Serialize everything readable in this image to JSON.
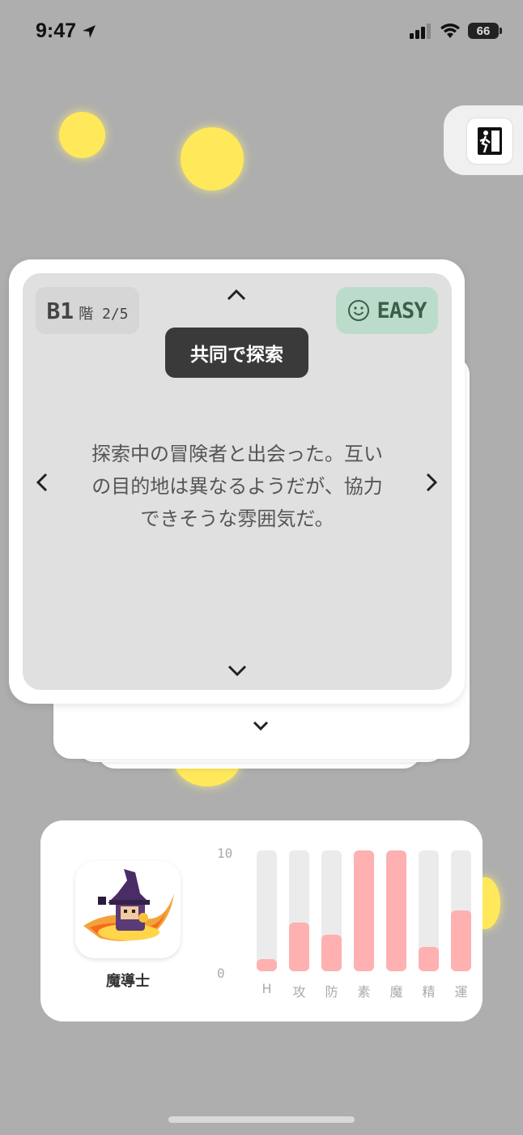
{
  "status": {
    "time": "9:47",
    "battery": "66"
  },
  "colors": {
    "background": "#aeaeae",
    "bubble": "#ffe95a",
    "bar_fill": "#ffb0b0",
    "bar_track": "#ebebeb",
    "easy_bg": "#bcdccb"
  },
  "exit": {
    "icon": "exit-running-icon"
  },
  "event_card": {
    "floor": "B1",
    "floor_progress": "階 2/5",
    "difficulty": "EASY",
    "difficulty_icon": "smiley-icon",
    "title": "共同で探索",
    "story_lines": [
      "探索中の冒険者と出会った。互い",
      "の目的地は異なるようだが、協力",
      "できそうな雰囲気だ。"
    ]
  },
  "character": {
    "name": "魔導士",
    "axis_max": "10",
    "axis_min": "0",
    "stats": [
      {
        "label": "H",
        "value": 1
      },
      {
        "label": "攻",
        "value": 4
      },
      {
        "label": "防",
        "value": 3
      },
      {
        "label": "素",
        "value": 10
      },
      {
        "label": "魔",
        "value": 10
      },
      {
        "label": "精",
        "value": 2
      },
      {
        "label": "運",
        "value": 5
      }
    ]
  }
}
